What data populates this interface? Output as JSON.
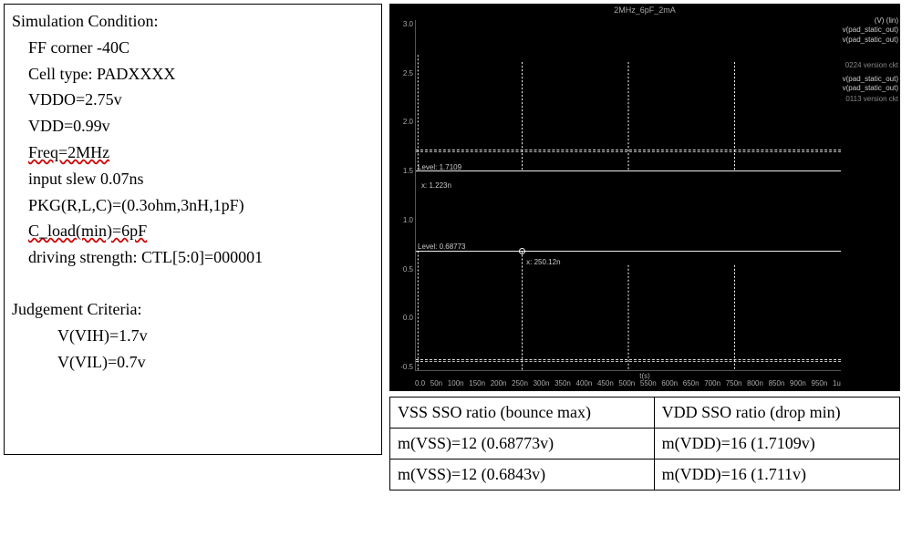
{
  "sim_condition": {
    "title": "Simulation Condition:",
    "lines": {
      "corner": "FF corner  -40C",
      "cell": "Cell type:   PADXXXX",
      "vddo": "VDDO=2.75v",
      "vdd": "VDD=0.99v",
      "freq": "Freq=2MHz",
      "slew": "input slew 0.07ns",
      "pkg": "PKG(R,L,C)=(0.3ohm,3nH,1pF)",
      "cload": "C_load(min)=6pF",
      "drv": "driving strength: CTL[5:0]=000001"
    },
    "judge_title": "Judgement Criteria:",
    "vih": "V(VIH)=1.7v",
    "vil": "V(VIL)=0.7v"
  },
  "plot": {
    "title": "2MHz_6pF_2mA",
    "ylabel_top": "(V) (lin)",
    "legend": [
      "v(pad_static_out)",
      "v(pad_static_out)",
      "v(pad_static_out)",
      "v(pad_static_out)"
    ],
    "annot_a": "0224 version ckt",
    "annot_b": "0113 version ckt",
    "cursors": {
      "top_level": "Level: 1.7109",
      "top_x": "x: 1.223n",
      "bot_level": "Level: 0.68773",
      "bot_x": "x: 250.12n"
    },
    "yticks": [
      "3.0",
      "2.5",
      "2.0",
      "1.5",
      "1.0",
      "0.5",
      "0.0",
      "-0.5"
    ],
    "xticks": [
      "0.0",
      "50n",
      "100n",
      "150n",
      "200n",
      "250n",
      "300n",
      "350n",
      "400n",
      "450n",
      "500n",
      "550n",
      "600n",
      "650n",
      "700n",
      "750n",
      "800n",
      "850n",
      "900n",
      "950n",
      "1u"
    ],
    "xlabel": "t(s)"
  },
  "chart_data": [
    {
      "type": "line",
      "title": "2MHz_6pF_2mA (top pane: VDD drop)",
      "xlabel": "t(s)",
      "ylabel": "V",
      "ylim": [
        1.5,
        3.0
      ],
      "xlim": [
        0,
        1e-06
      ],
      "series": [
        {
          "name": "v(pad_static_out) 0224",
          "baseline": 1.7109,
          "spike_times_ns": [
            0,
            250,
            500,
            750
          ],
          "spike_amplitude_v": 0.9
        },
        {
          "name": "v(pad_static_out) 0113",
          "baseline": 1.711,
          "spike_times_ns": [
            0,
            250,
            500,
            750
          ],
          "spike_amplitude_v": 0.9
        }
      ],
      "cursor": {
        "level": 1.7109,
        "x_ns": 1.223
      }
    },
    {
      "type": "line",
      "title": "2MHz_6pF_2mA (bottom pane: VSS bounce)",
      "xlabel": "t(s)",
      "ylabel": "V",
      "ylim": [
        -0.5,
        1.5
      ],
      "xlim": [
        0,
        1e-06
      ],
      "series": [
        {
          "name": "v(pad_static_out) 0224",
          "baseline": 0.68773,
          "spike_times_ns": [
            0,
            250,
            500,
            750
          ],
          "spike_amplitude_v": 0.9
        },
        {
          "name": "v(pad_static_out) 0113",
          "baseline": 0.6843,
          "spike_times_ns": [
            0,
            250,
            500,
            750
          ],
          "spike_amplitude_v": 0.9
        }
      ],
      "cursor": {
        "level": 0.68773,
        "x_ns": 250.12
      }
    }
  ],
  "table": {
    "headers": {
      "vss": "VSS SSO ratio (bounce max)",
      "vdd": "VDD SSO ratio (drop min)"
    },
    "rows": [
      {
        "vss": "m(VSS)=12   (0.68773v)",
        "vdd": "m(VDD)=16   (1.7109v)"
      },
      {
        "vss": "m(VSS)=12   (0.6843v)",
        "vdd": "m(VDD)=16   (1.711v)"
      }
    ]
  }
}
